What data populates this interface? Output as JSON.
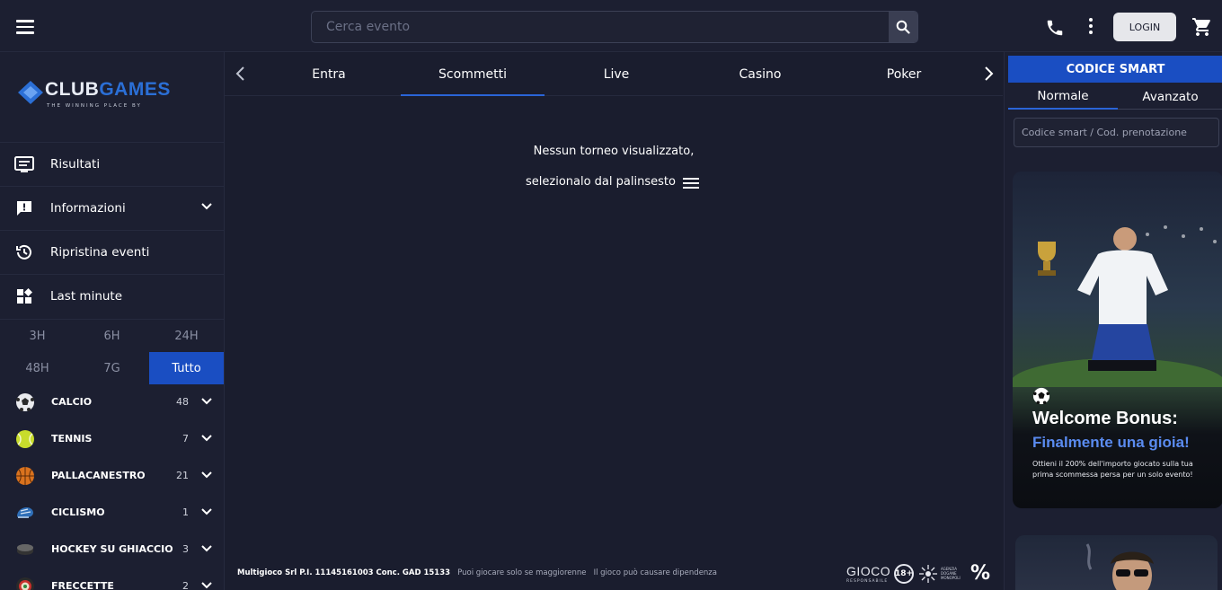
{
  "header": {
    "search_placeholder": "Cerca evento",
    "login_label": "LOGIN"
  },
  "logo": {
    "name_white": "CLUB",
    "name_blue": "GAMES",
    "tagline": "THE WINNING PLACE BY"
  },
  "sidebar": {
    "menu": [
      {
        "label": "Risultati",
        "icon": "results-icon"
      },
      {
        "label": "Informazioni",
        "icon": "info-icon",
        "expandable": true
      },
      {
        "label": "Ripristina eventi",
        "icon": "history-icon"
      },
      {
        "label": "Last minute",
        "icon": "dashboard-icon"
      }
    ],
    "time_filters": [
      "3H",
      "6H",
      "24H",
      "48H",
      "7G",
      "Tutto"
    ],
    "active_time_filter": "Tutto",
    "sports": [
      {
        "name": "CALCIO",
        "count": "48",
        "icon": "soccer-ball-icon"
      },
      {
        "name": "TENNIS",
        "count": "7",
        "icon": "tennis-ball-icon"
      },
      {
        "name": "PALLACANESTRO",
        "count": "21",
        "icon": "basketball-icon"
      },
      {
        "name": "CICLISMO",
        "count": "1",
        "icon": "cycling-helmet-icon"
      },
      {
        "name": "HOCKEY SU GHIACCIO",
        "count": "3",
        "icon": "hockey-puck-icon"
      },
      {
        "name": "FRECCETTE",
        "count": "2",
        "icon": "darts-icon"
      }
    ]
  },
  "main": {
    "tabs": [
      "Entra",
      "Scommetti",
      "Live",
      "Casino",
      "Poker"
    ],
    "active_tab": "Scommetti",
    "empty_line1": "Nessun torneo visualizzato,",
    "empty_line2": "selezionalo dal palinsesto"
  },
  "footer": {
    "company": "Multigioco Srl P.I. 11145161003 Conc. GAD 15133",
    "notice1": "Puoi giocare solo se maggiorenne",
    "notice2": "Il gioco può causare dipendenza",
    "gioco": "GIOCO",
    "gioco_sub": "RESPONSABILE",
    "age": "18+",
    "adm": "AGENZIA DOGANE MONOPOLI",
    "percent": "%"
  },
  "right_panel": {
    "codice_title": "CODICE SMART",
    "subtab_normale": "Normale",
    "subtab_avanzato": "Avanzato",
    "codice_placeholder": "Codice smart / Cod. prenotazione",
    "promo_title": "Welcome Bonus:",
    "promo_subtitle": "Finalmente una gioia!",
    "promo_desc": "Ottieni il 200% dell'importo giocato sulla tua prima scommessa persa per un solo evento!"
  },
  "colors": {
    "background": "#1a1d2e",
    "accent_blue": "#1a4ec2",
    "promo_highlight": "#5a8bf0"
  }
}
